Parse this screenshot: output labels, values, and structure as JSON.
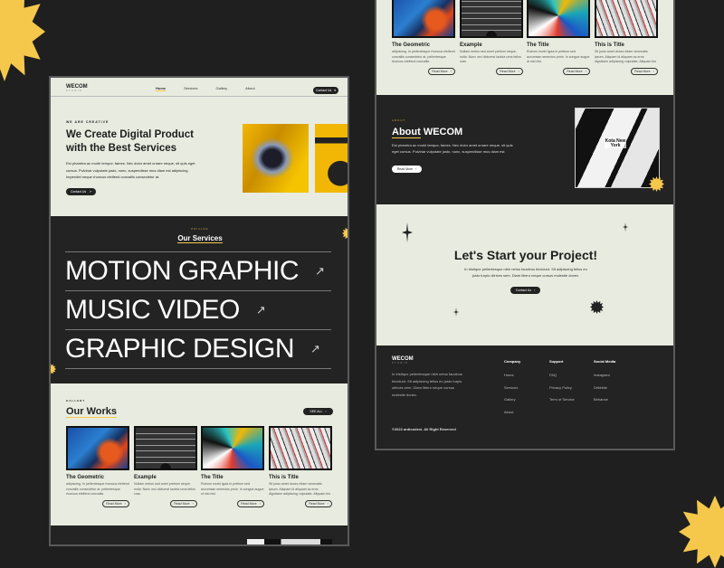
{
  "brand": {
    "name": "WECOM",
    "sub": "STUDIO"
  },
  "nav": {
    "items": [
      "Home",
      "Services",
      "Gallery",
      "About"
    ],
    "contact": "Contact Us"
  },
  "hero": {
    "eyebrow": "WE ARE CREATIVE",
    "title_1": "We Create Digital Product",
    "title_2": "with the Best Services",
    "text": "Est pharetra ac morbi tempor, fames. Nec dolor amet ornare neque, sit quis eget cursus. Pulvinar vulputate justo, nunc, suspendisse mus diam est adipiscing. Imperdiet neque rhoncus eleifend convallis consectetur at.",
    "button": "Contact Us"
  },
  "services": {
    "eyebrow": "PRICING",
    "title": "Our Services",
    "items": [
      "MOTION GRAPHIC",
      "MUSIC VIDEO",
      "GRAPHIC DESIGN"
    ]
  },
  "works": {
    "eyebrow": "GALLERY",
    "title": "Our Works",
    "see_all": "SEE ALL",
    "items": [
      {
        "title": "The Geometric",
        "desc": "adipiscing. In pellentesque rhoncus eleifend convallis consectetur at. pellentesque rhoncus eleifend convallis.",
        "button": "Read More"
      },
      {
        "title": "Example",
        "desc": "Nullam metus sed amet pretium neque, nulla. Nunc orci dictumst lacinia urna tellus cras.",
        "button": "Read More"
      },
      {
        "title": "The Title",
        "desc": "Rutrum morbi igula in pretium sed accumsan senectus proin. In congue augue ut nisl nisl.",
        "button": "Read More"
      },
      {
        "title": "This is Title",
        "desc": "Sit justo amet donec etiam venenatis ipsum. Aliquam id aliquam ac eros dignissim adipiscing vulputate. Aliquam leo vel massa dui neque.",
        "button": "Read More"
      }
    ]
  },
  "about": {
    "eyebrow": "ABOUT",
    "title_a": "About",
    "title_b": "WECOM",
    "text": "Est pharetra ac morbi tempor, fames. Nec dolor amet ornare neque, sit quis eget cursus. Pulvinar vulputate justo, nunc, suspendisse mus diam est",
    "button": "Read More",
    "map_label": "Kota New York"
  },
  "cta": {
    "title": "Let's Start your Project!",
    "text": "In tristique pellentesque nibh netus faucibus tincidunt. Sit adipiscing tellus eu justo turpis ultrices sem. Diam libero neque cursus molestie donec.",
    "button": "Contact Us"
  },
  "footer": {
    "about": "In tristique pellentesque nibh netus faucibus tincidunt. Sit adipiscing tellus eu justo turpis ultrices sem. Diam libero neque cursus molestie donec.",
    "columns": [
      {
        "title": "Company",
        "links": [
          "Home",
          "Services",
          "Gallery",
          "About"
        ]
      },
      {
        "title": "Support",
        "links": [
          "FAQ",
          "Privacy Policy",
          "Term of Service"
        ]
      },
      {
        "title": "Social Media",
        "links": [
          "Instagram",
          "Dribbble",
          "Behance"
        ]
      }
    ],
    "copyright": "©2022 ardiondevi. All Right Reserved"
  }
}
